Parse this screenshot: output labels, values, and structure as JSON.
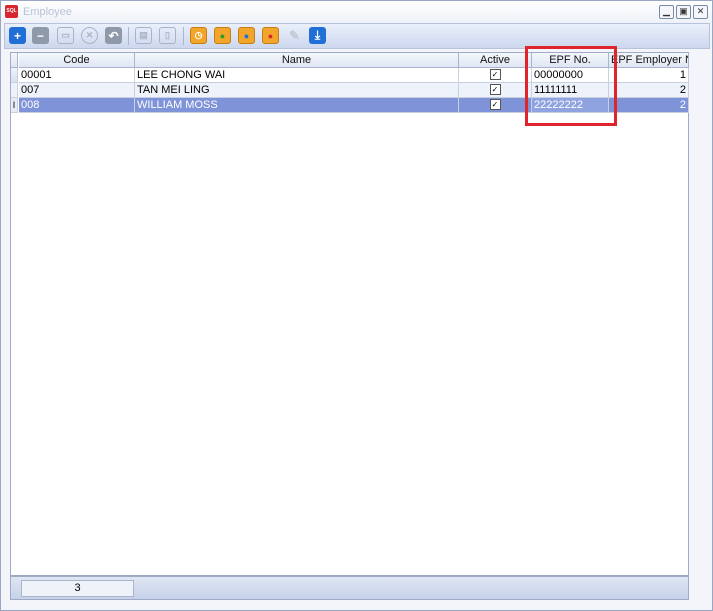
{
  "window": {
    "title": "Employee",
    "logo_text": "SQL"
  },
  "toolbar": {
    "new_icon": "+",
    "delete_icon": "−",
    "save_icon": "💾",
    "cancel_icon": "✕",
    "undo_icon": "↶",
    "print_icon": "⎙",
    "preview_icon": "🗎"
  },
  "grid": {
    "columns": [
      "Code",
      "Name",
      "Active",
      "EPF No.",
      "EPF Employer No"
    ],
    "rows": [
      {
        "code": "00001",
        "name": "LEE CHONG WAI",
        "active": "✓",
        "epf_no": "00000000",
        "epf_employer_no": "1"
      },
      {
        "code": "007",
        "name": "TAN MEI LING",
        "active": "✓",
        "epf_no": "11111111",
        "epf_employer_no": "2"
      },
      {
        "code": "008",
        "name": "WILLIAM MOSS",
        "active": "✓",
        "epf_no": "22222222",
        "epf_employer_no": "2"
      }
    ]
  },
  "footer": {
    "record_count": "3"
  },
  "colors": {
    "selected_row": "#7f93d8",
    "highlight": "#e0242c",
    "accent": "#1f6fd6"
  }
}
